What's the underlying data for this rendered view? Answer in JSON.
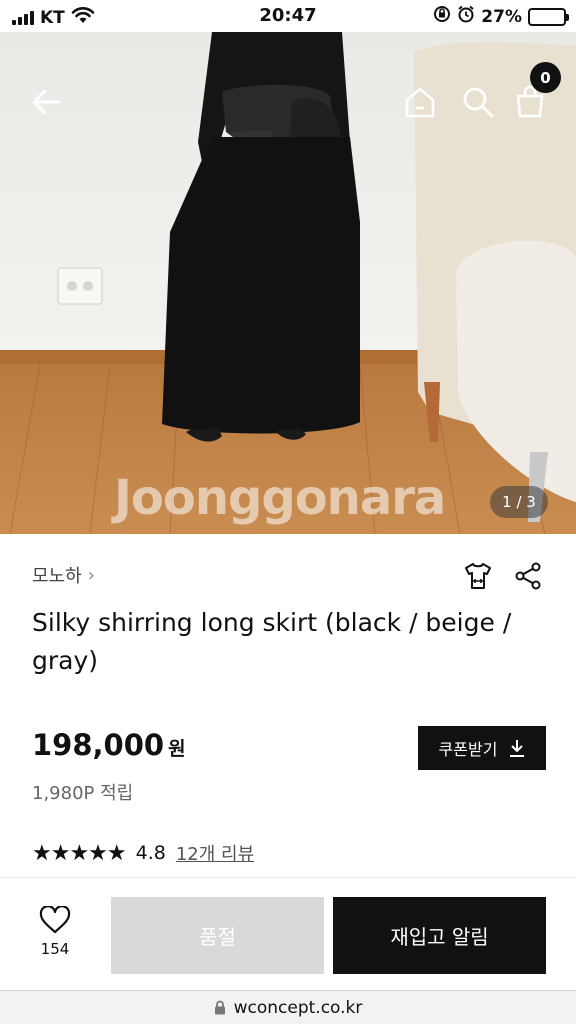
{
  "status_bar": {
    "carrier": "KT",
    "time": "20:47",
    "battery_percent": "27%",
    "battery_level": 0.27,
    "icons": [
      "signal-icon",
      "wifi-icon",
      "orientation-lock-icon",
      "alarm-icon",
      "battery-charging-icon"
    ]
  },
  "hero": {
    "watermark": "Joonggonara",
    "pager": "1 / 3",
    "cart_count": "0",
    "icons": [
      "back-arrow-icon",
      "home-icon",
      "search-icon",
      "shopping-bag-icon"
    ]
  },
  "product": {
    "brand": "모노하",
    "brand_chevron": "›",
    "title": "Silky shirring long skirt (black / beige / gray)",
    "price": "198,000",
    "currency": "원",
    "points": "1,980P 적립",
    "coupon_label": "쿠폰받기",
    "rating_stars": "★★★★★",
    "rating_value": "4.8",
    "reviews_link": "12개 리뷰",
    "icons": [
      "size-guide-shirt-icon",
      "share-icon",
      "download-icon"
    ]
  },
  "actions": {
    "like_count": "154",
    "soldout_label": "품절",
    "restock_label": "재입고 알림",
    "icons": [
      "heart-icon"
    ]
  },
  "browser": {
    "url": "wconcept.co.kr",
    "icons": [
      "lock-icon"
    ]
  },
  "colors": {
    "primary": "#111111",
    "disabled": "#d9d9d9",
    "battery_fill": "#3fc43f"
  }
}
